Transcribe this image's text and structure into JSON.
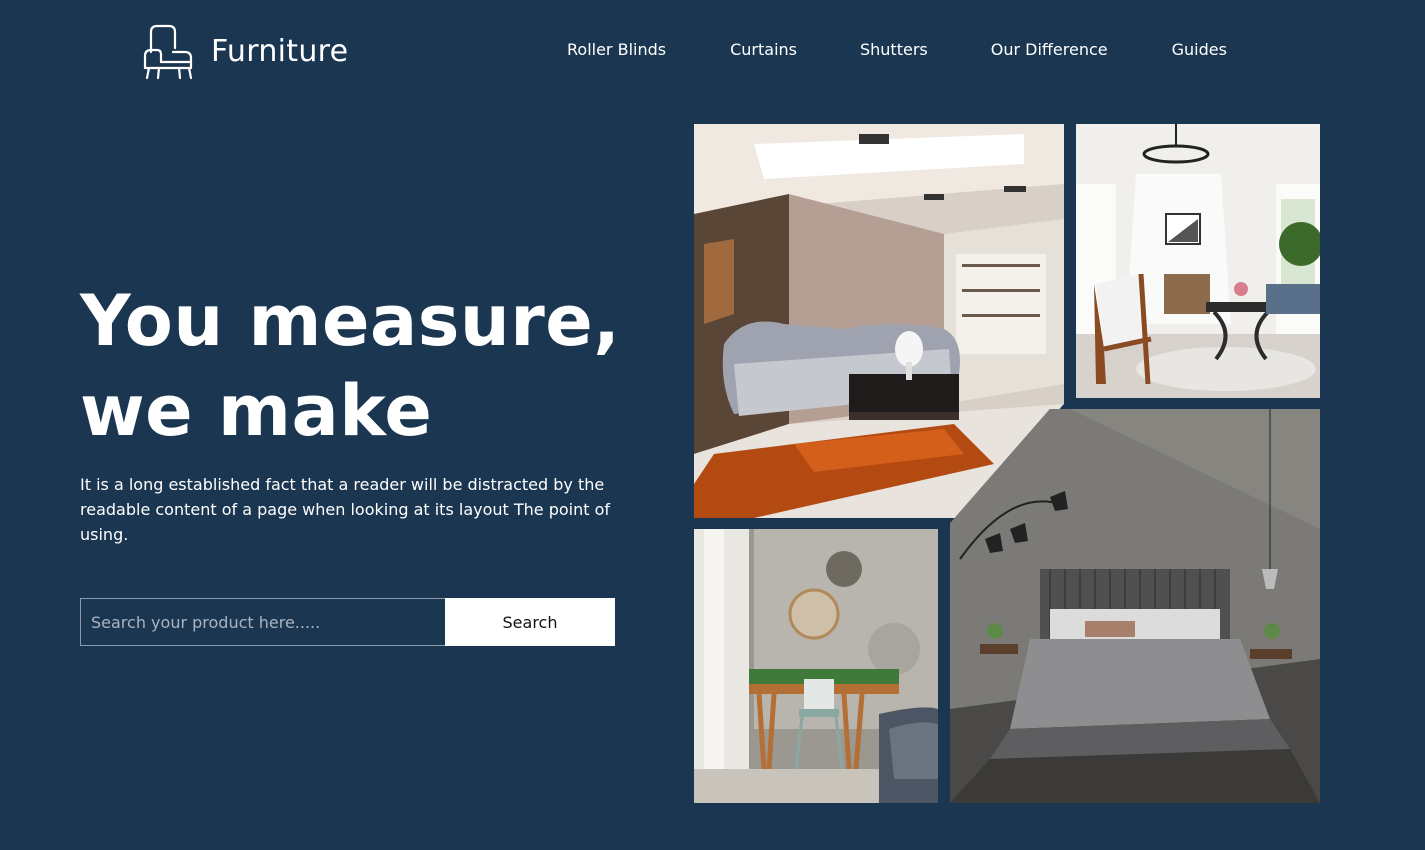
{
  "brand": {
    "name": "Furniture",
    "icon": "armchair-icon"
  },
  "nav": {
    "items": [
      {
        "label": "Roller Blinds"
      },
      {
        "label": "Curtains"
      },
      {
        "label": "Shutters"
      },
      {
        "label": "Our Difference"
      },
      {
        "label": "Guides"
      }
    ]
  },
  "hero": {
    "title_line1": "You measure,",
    "title_line2": "we make",
    "description": "It is a long established fact that a reader will be distracted by the readable content of a page when looking at its layout The point of using."
  },
  "search": {
    "placeholder": "Search your product here.....",
    "value": "",
    "button_label": "Search"
  },
  "gallery": {
    "images": [
      "living-room-photo",
      "fireplace-room-photo",
      "bedroom-desk-photo",
      "gray-bedroom-photo"
    ]
  },
  "colors": {
    "background": "#1b3651",
    "text": "#ffffff",
    "button_bg": "#ffffff"
  }
}
